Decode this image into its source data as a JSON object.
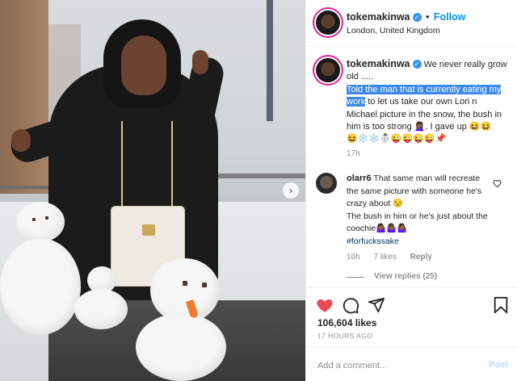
{
  "post": {
    "username": "tokemakinwa",
    "follow_label": "Follow",
    "location": "London, United Kingdom",
    "caption": {
      "intro": "We never really grow old .....",
      "highlighted": "Told the man that is currently eating my work",
      "rest": " to let us take our own Lori n Michael picture in the snow, the bush in him is too strong 🤦🏾‍♀️. I gave up 😆😆",
      "emoji_line": "😆❄️❄️☃️😜😜😜😜📌",
      "time": "17h"
    },
    "comment": {
      "username": "olarr6",
      "text": "That same man will recreate the same picture with someone he's crazy about 😒",
      "line2": "The bush in him or he's just about the coochie🤷🏾‍♀️🤷🏾‍♀️🤷🏾‍♀️",
      "tag": "#forfuckssake",
      "time": "16h",
      "likes": "7 likes",
      "reply_label": "Reply",
      "view_replies": "View replies (25)"
    },
    "likes_count": "106,604 likes",
    "time_ago": "17 HOURS AGO",
    "comment_placeholder": "Add a comment...",
    "post_button": "Post"
  },
  "icons": {
    "like": "heart-icon",
    "comment": "comment-icon",
    "share": "share-icon",
    "save": "bookmark-icon",
    "verified": "verified-badge",
    "next": "chevron-right-icon"
  },
  "colors": {
    "link": "#0095f6",
    "like": "#ed4956",
    "highlight": "#3c8ae8",
    "muted": "#8e8e8e"
  }
}
